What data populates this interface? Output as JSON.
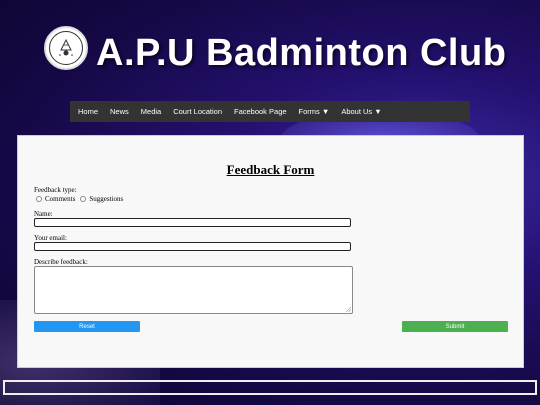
{
  "site": {
    "title": "A.P.U Badminton Club"
  },
  "nav": {
    "home": "Home",
    "news": "News",
    "media": "Media",
    "court": "Court Location",
    "facebook": "Facebook Page",
    "forms": "Forms ▼",
    "about": "About Us ▼"
  },
  "form": {
    "title": "Feedback Form",
    "type_label": "Feedback type:",
    "option_comments": "Comments",
    "option_suggestions": "Suggestions",
    "name_label": "Name:",
    "name_value": "",
    "email_label": "Your email:",
    "email_value": "",
    "describe_label": "Describe feedback:",
    "describe_value": "",
    "reset_label": "Reset",
    "submit_label": "Submit"
  },
  "colors": {
    "reset": "#2196f3",
    "submit": "#4caf50",
    "nav_bg": "#333333"
  }
}
